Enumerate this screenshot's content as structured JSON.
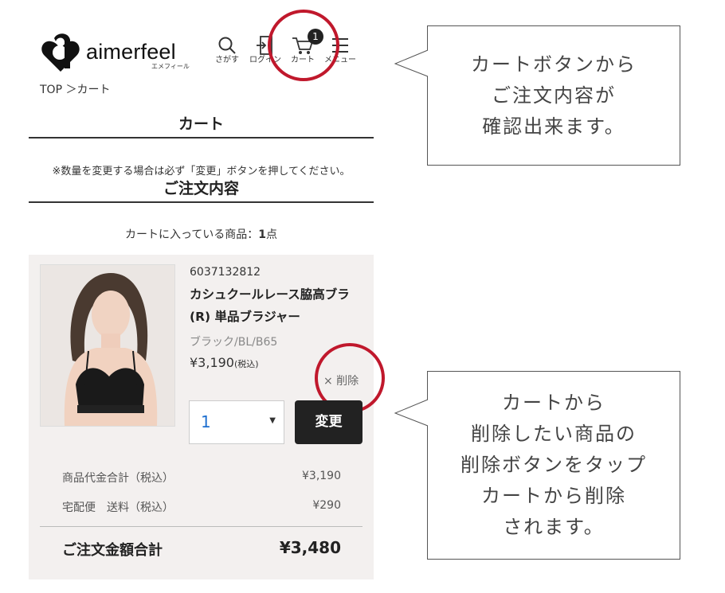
{
  "header": {
    "logo_text": "aimerfeel",
    "logo_subtext": "エメフィール",
    "nav": [
      {
        "label": "さがす",
        "icon": "search-icon"
      },
      {
        "label": "ログイン",
        "icon": "login-icon"
      },
      {
        "label": "カート",
        "icon": "cart-icon"
      },
      {
        "label": "メニュー",
        "icon": "menu-icon"
      }
    ],
    "cart_count": "1"
  },
  "breadcrumb": "TOP ＞カート",
  "page_title": "カート",
  "notice": "※数量を変更する場合は必ず「変更」ボタンを押してください。",
  "order_title": "ご注文内容",
  "cart_count_label": "カートに入っている商品：",
  "cart_count_value": "1",
  "cart_count_unit": "点",
  "item": {
    "sku": "6037132812",
    "name": "カシュクールレース脇高ブラ(R) 単品ブラジャー",
    "variant": "ブラック/BL/B65",
    "price": "¥3,190",
    "price_tax": "(税込)",
    "delete_label": "× 削除",
    "quantity": "1",
    "change_label": "変更"
  },
  "summary": {
    "subtotal_label": "商品代金合計（税込）",
    "subtotal_value": "¥3,190",
    "shipping_label": "宅配便　送料（税込）",
    "shipping_value": "¥290",
    "total_label": "ご注文金額合計",
    "total_value": "¥3,480"
  },
  "callouts": {
    "top": [
      "カートボタンから",
      "ご注文内容が",
      "確認出来ます。"
    ],
    "bottom": [
      "カートから",
      "削除したい商品の",
      "削除ボタンをタップ",
      "カートから削除",
      "されます。"
    ]
  },
  "colors": {
    "highlight": "#c0182c",
    "panel": "#f3f0ef",
    "button": "#222222",
    "qty_text": "#1e6fd0"
  }
}
